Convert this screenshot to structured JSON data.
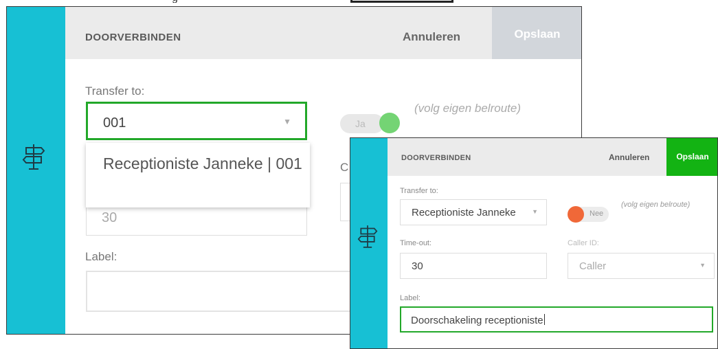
{
  "panel_before": {
    "header": {
      "title": "DOORVERBINDEN",
      "cancel_label": "Annuleren",
      "save_label": "Opslaan"
    },
    "transfer_to": {
      "label": "Transfer to:",
      "value": "001",
      "dropdown_option": "Receptioniste Janneke | 001"
    },
    "follow_route": {
      "toggle_label": "Ja",
      "state": "on",
      "note": "(volg eigen belroute)"
    },
    "timeout": {
      "value": "30"
    },
    "caller_id": {
      "label": "C"
    },
    "label_field": {
      "label": "Label:",
      "value": ""
    }
  },
  "panel_after": {
    "header": {
      "title": "DOORVERBINDEN",
      "cancel_label": "Annuleren",
      "save_label": "Opslaan"
    },
    "transfer_to": {
      "label": "Transfer to:",
      "value": "Receptioniste Janneke"
    },
    "follow_route": {
      "toggle_label": "Nee",
      "state": "off",
      "note": "(volg eigen belroute)"
    },
    "timeout": {
      "label": "Time-out:",
      "value": "30"
    },
    "caller_id": {
      "label": "Caller ID:",
      "value": "Caller"
    },
    "label_field": {
      "label": "Label:",
      "value": "Doorschakeling receptioniste"
    }
  },
  "colors": {
    "sidebar": "#17c0d4",
    "focus_border": "#22a829",
    "save_active": "#13b313",
    "save_disabled": "#d2d6db",
    "toggle_on": "#74d474",
    "toggle_off": "#f06838"
  },
  "icons": {
    "sidebar_icon": "signpost-icon",
    "dropdown_icon": "chevron-down-icon"
  }
}
